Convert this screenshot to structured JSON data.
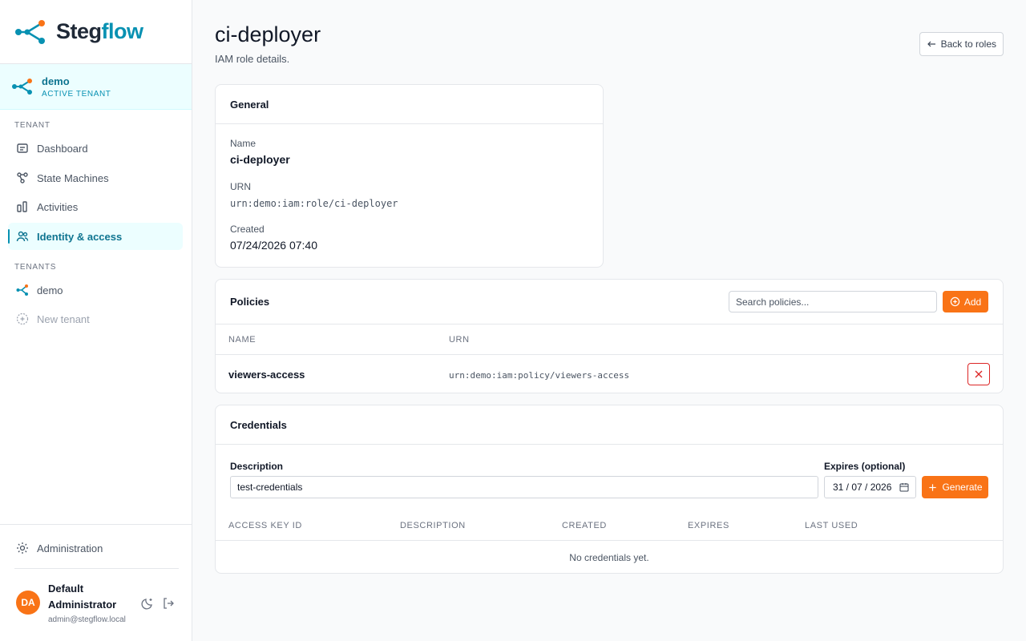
{
  "brand": {
    "name_part1": "Steg",
    "name_part2": "flow",
    "accent": "#0891b2",
    "icon": "network-logo-icon"
  },
  "active_tenant": {
    "name": "demo",
    "tag": "ACTIVE TENANT"
  },
  "sidebar": {
    "tenant_section": "TENANT",
    "items": [
      {
        "label": "Dashboard",
        "icon": "dashboard-icon"
      },
      {
        "label": "State Machines",
        "icon": "state-machines-icon"
      },
      {
        "label": "Activities",
        "icon": "activities-icon"
      },
      {
        "label": "Identity & access",
        "icon": "users-icon",
        "active": true
      }
    ],
    "tenants_section": "TENANTS",
    "tenants": [
      {
        "label": "demo"
      }
    ],
    "new_tenant": "New tenant",
    "administration": "Administration"
  },
  "user": {
    "initials": "DA",
    "name": "Default Administrator",
    "email": "admin@stegflow.local"
  },
  "page": {
    "title": "ci-deployer",
    "subtitle": "IAM role details.",
    "back_label": "Back to roles"
  },
  "general": {
    "title": "General",
    "name_label": "Name",
    "name_value": "ci-deployer",
    "urn_label": "URN",
    "urn_value": "urn:demo:iam:role/ci-deployer",
    "created_label": "Created",
    "created_value": "07/24/2026 07:40"
  },
  "policies": {
    "title": "Policies",
    "search_placeholder": "Search policies...",
    "add_label": "Add",
    "columns": [
      "NAME",
      "URN"
    ],
    "rows": [
      {
        "name": "viewers-access",
        "urn": "urn:demo:iam:policy/viewers-access"
      }
    ]
  },
  "credentials": {
    "title": "Credentials",
    "description_label": "Description",
    "description_value": "test-credentials",
    "expires_label": "Expires (optional)",
    "expires_value": "31 / 07 / 2026",
    "generate_label": "Generate",
    "columns": [
      "ACCESS KEY ID",
      "DESCRIPTION",
      "CREATED",
      "EXPIRES",
      "LAST USED"
    ],
    "empty_text": "No credentials yet."
  },
  "colors": {
    "primary_orange": "#f97316",
    "danger": "#dc2626",
    "active_bg": "#ecfeff"
  }
}
